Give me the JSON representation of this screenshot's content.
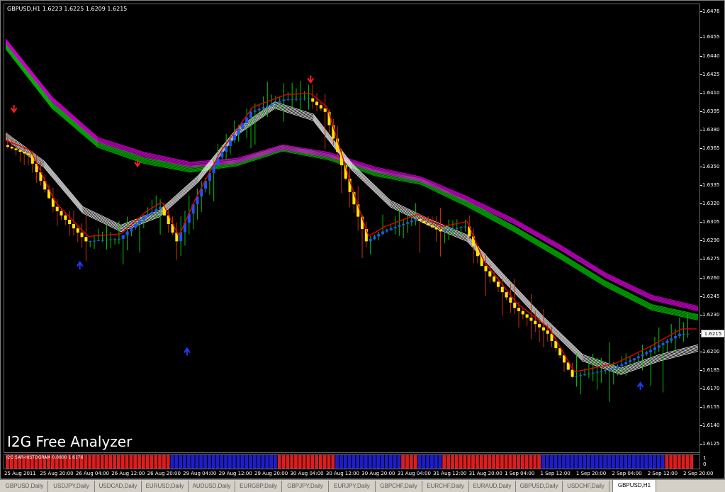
{
  "chart_header": "GBPUSD,H1  1.6223 1.6225 1.6209 1.6215",
  "watermark": "I2G Free Analyzer",
  "price_axis": [
    "1.6476",
    "1.6455",
    "1.6440",
    "1.6425",
    "1.6410",
    "1.6395",
    "1.6380",
    "1.6365",
    "1.6350",
    "1.6335",
    "1.6320",
    "1.6305",
    "1.6290",
    "1.6275",
    "1.6260",
    "1.6245",
    "1.6230",
    "1.6215",
    "1.6200",
    "1.6185",
    "1.6170",
    "1.6155",
    "1.6140",
    "1.6125"
  ],
  "current_price": "1.6215",
  "sub_indicator_label": "I2G SAR-HISTOGRAM 0.0000 1.6176",
  "sub_axis": [
    "1",
    "0"
  ],
  "time_axis": [
    "25 Aug 2011",
    "25 Aug 20:00",
    "26 Aug 04:00",
    "26 Aug 12:00",
    "26 Aug 20:00",
    "29 Aug 04:00",
    "29 Aug 12:00",
    "29 Aug 20:00",
    "30 Aug 04:00",
    "30 Aug 12:00",
    "30 Aug 20:00",
    "31 Aug 04:00",
    "31 Aug 12:00",
    "31 Aug 20:00",
    "1 Sep 04:00",
    "1 Sep 12:00",
    "1 Sep 20:00",
    "2 Sep 04:00",
    "2 Sep 12:00",
    "2 Sep 20:00"
  ],
  "tabs": [
    "GBPUSD,Daily",
    "USDJPY,Daily",
    "USDCAD,Daily",
    "EURUSD,Daily",
    "AUDUSD,Daily",
    "EURGBP,Daily",
    "GBPJPY,Daily",
    "EURJPY,Daily",
    "GBPCHF,Daily",
    "EURCHF,Daily",
    "EURAUD,Daily",
    "GBPUSD,Daily",
    "USDCHF,Daily",
    "GBPUSD,H1"
  ],
  "active_tab": "GBPUSD,H1",
  "colors": {
    "background": "#000000",
    "bull_candle": "#00c800",
    "bear_candle": "#c83200",
    "up_arrow": "#1e3cff",
    "down_arrow": "#ff1e1e",
    "ema_fast": "#ffffff",
    "ema_slow_green": "#00c800",
    "ema_slow_magenta": "#e600e6",
    "histogram_up": "#1e1ec8",
    "histogram_down": "#dc1e1e",
    "tab_bar": "#d4d0c8"
  },
  "chart_data": {
    "type": "candlestick",
    "symbol": "GBPUSD",
    "timeframe": "H1",
    "ylim": [
      1.612,
      1.648
    ],
    "close_path": [
      {
        "t": "25 Aug 2011 00:00",
        "close": 1.6368
      },
      {
        "t": "25 Aug 2011 06:00",
        "close": 1.636
      },
      {
        "t": "25 Aug 2011 12:00",
        "close": 1.6318
      },
      {
        "t": "25 Aug 2011 20:00",
        "close": 1.629
      },
      {
        "t": "26 Aug 2011 04:00",
        "close": 1.6292
      },
      {
        "t": "26 Aug 2011 10:00",
        "close": 1.631
      },
      {
        "t": "26 Aug 2011 14:00",
        "close": 1.6318
      },
      {
        "t": "26 Aug 2011 18:00",
        "close": 1.629
      },
      {
        "t": "26 Aug 2011 22:00",
        "close": 1.632
      },
      {
        "t": "29 Aug 2011 04:00",
        "close": 1.6358
      },
      {
        "t": "29 Aug 2011 12:00",
        "close": 1.6395
      },
      {
        "t": "29 Aug 2011 20:00",
        "close": 1.6405
      },
      {
        "t": "30 Aug 2011 02:00",
        "close": 1.6406
      },
      {
        "t": "30 Aug 2011 06:00",
        "close": 1.6395
      },
      {
        "t": "30 Aug 2011 12:00",
        "close": 1.633
      },
      {
        "t": "30 Aug 2011 16:00",
        "close": 1.629
      },
      {
        "t": "30 Aug 2011 20:00",
        "close": 1.6298
      },
      {
        "t": "31 Aug 2011 04:00",
        "close": 1.6308
      },
      {
        "t": "31 Aug 2011 10:00",
        "close": 1.6298
      },
      {
        "t": "31 Aug 2011 16:00",
        "close": 1.6302
      },
      {
        "t": "31 Aug 2011 20:00",
        "close": 1.627
      },
      {
        "t": "1 Sep 2011 04:00",
        "close": 1.6236
      },
      {
        "t": "1 Sep 2011 12:00",
        "close": 1.6215
      },
      {
        "t": "1 Sep 2011 18:00",
        "close": 1.618
      },
      {
        "t": "2 Sep 2011 04:00",
        "close": 1.6187
      },
      {
        "t": "2 Sep 2011 12:00",
        "close": 1.62
      },
      {
        "t": "2 Sep 2011 20:00",
        "close": 1.6215
      }
    ],
    "ema_white": [
      1.6375,
      1.6352,
      1.6315,
      1.63,
      1.6312,
      1.634,
      1.6378,
      1.64,
      1.639,
      1.635,
      1.632,
      1.6305,
      1.6292,
      1.6258,
      1.6225,
      1.6195,
      1.6184,
      1.6195,
      1.6203
    ],
    "ema_green": [
      1.6448,
      1.64,
      1.6368,
      1.6355,
      1.6348,
      1.6353,
      1.6365,
      1.6358,
      1.6345,
      1.6338,
      1.632,
      1.63,
      1.6278,
      1.6255,
      1.6236,
      1.6228
    ],
    "ema_magenta": [
      1.6452,
      1.6405,
      1.6372,
      1.636,
      1.6352,
      1.6355,
      1.6366,
      1.636,
      1.6348,
      1.634,
      1.6324,
      1.6306,
      1.6285,
      1.6262,
      1.6244,
      1.6235
    ],
    "down_arrows": [
      {
        "t": "25 Aug 2011 02:00",
        "price": 1.6396
      },
      {
        "t": "26 Aug 2011 08:00",
        "price": 1.6352
      },
      {
        "t": "30 Aug 2011 02:00",
        "price": 1.642
      }
    ],
    "up_arrows": [
      {
        "t": "25 Aug 2011 18:00",
        "price": 1.6272
      },
      {
        "t": "26 Aug 2011 20:00",
        "price": 1.6202
      },
      {
        "t": "2 Sep 2011 10:00",
        "price": 1.6174
      }
    ],
    "histogram_segments": [
      {
        "sign": "down",
        "from": "25 Aug 2011 00:00",
        "to": "26 Aug 2011 16:00"
      },
      {
        "sign": "up",
        "from": "26 Aug 2011 16:00",
        "to": "29 Aug 2011 18:00"
      },
      {
        "sign": "down",
        "from": "29 Aug 2011 18:00",
        "to": "30 Aug 2011 08:00"
      },
      {
        "sign": "up",
        "from": "30 Aug 2011 08:00",
        "to": "31 Aug 2011 00:00"
      },
      {
        "sign": "down",
        "from": "31 Aug 2011 00:00",
        "to": "31 Aug 2011 04:00"
      },
      {
        "sign": "up",
        "from": "31 Aug 2011 04:00",
        "to": "31 Aug 2011 10:00"
      },
      {
        "sign": "down",
        "from": "31 Aug 2011 10:00",
        "to": "1 Sep 2011 10:00"
      },
      {
        "sign": "up",
        "from": "1 Sep 2011 10:00",
        "to": "2 Sep 2011 16:00"
      },
      {
        "sign": "down",
        "from": "2 Sep 2011 16:00",
        "to": "2 Sep 2011 22:00"
      }
    ]
  }
}
